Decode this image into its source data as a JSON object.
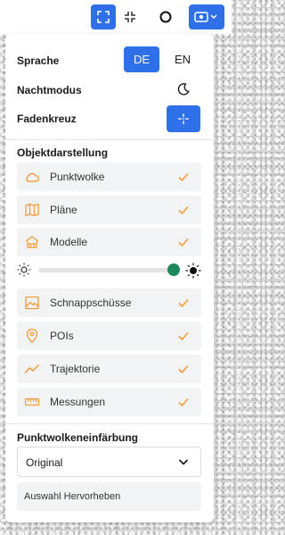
{
  "colors": {
    "accent": "#2f6fe8",
    "orange": "#f29b3a",
    "slider_thumb": "#1a8a5a"
  },
  "toolbar": {
    "expand_icon": "expand-icon",
    "shrink_icon": "shrink-icon",
    "circle_icon": "circle-icon",
    "view_icon": "eye-icon"
  },
  "settings": {
    "language_label": "Sprache",
    "lang_de": "DE",
    "lang_en": "EN",
    "language_selected": "DE",
    "night_mode_label": "Nachtmodus",
    "crosshair_label": "Fadenkreuz"
  },
  "object_display": {
    "heading": "Objektdarstellung",
    "items_top": [
      {
        "label": "Punktwolke",
        "icon": "cloud-icon",
        "checked": true
      },
      {
        "label": "Pläne",
        "icon": "map-icon",
        "checked": true
      },
      {
        "label": "Modelle",
        "icon": "building-icon",
        "checked": true
      }
    ],
    "brightness": 0.95,
    "items_bottom": [
      {
        "label": "Schnappschüsse",
        "icon": "image-icon",
        "checked": true
      },
      {
        "label": "POIs",
        "icon": "pin-icon",
        "checked": true
      },
      {
        "label": "Trajektorie",
        "icon": "trajectory-icon",
        "checked": true
      },
      {
        "label": "Messungen",
        "icon": "ruler-icon",
        "checked": true
      }
    ]
  },
  "coloring": {
    "heading": "Punktwolkeneinfärbung",
    "selected": "Original",
    "highlight_button": "Auswahl Hervorheben"
  }
}
